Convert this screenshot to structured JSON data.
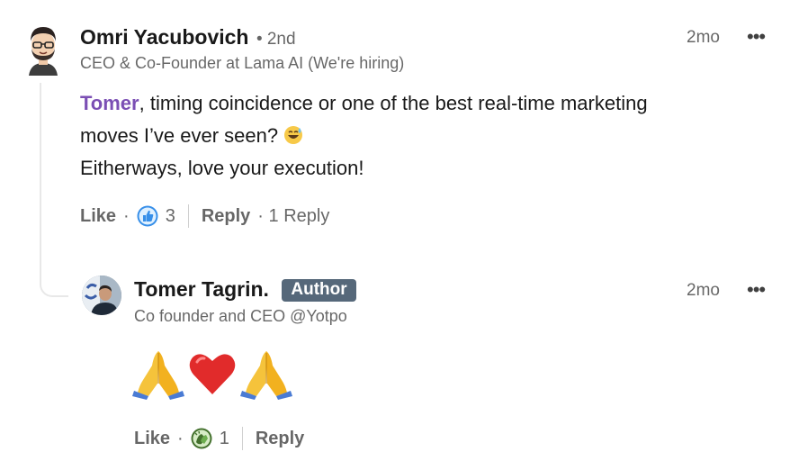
{
  "comment": {
    "author_name": "Omri Yacubovich",
    "degree": "• 2nd",
    "headline": "CEO & Co-Founder at Lama AI (We're hiring)",
    "time": "2mo",
    "more": "•••",
    "mention": "Tomer",
    "line1_rest": ", timing coincidence or one of the best real-time marketing",
    "line2": "moves I’ve ever seen?",
    "line2_emoji": "grinning-sweat-emoji",
    "line3": "Eitherways, love your execution!",
    "like_label": "Like",
    "reaction_icon": "thumbs-up-like-icon",
    "reaction_count": "3",
    "reply_label": "Reply",
    "replies_count_label": "· 1 Reply"
  },
  "reply": {
    "author_name": "Tomer Tagrin.",
    "badge": "Author",
    "headline": "Co founder and CEO @Yotpo",
    "time": "2mo",
    "more": "•••",
    "emojis": [
      "folded-hands-emoji",
      "red-heart-emoji",
      "folded-hands-emoji"
    ],
    "like_label": "Like",
    "reaction_icon": "clapping-celebrate-icon",
    "reaction_count": "1",
    "reply_label": "Reply"
  },
  "colors": {
    "mention": "#7b4fb4",
    "badge_bg": "#56687a",
    "like_blue": "#378fe9",
    "celebrate_green": "#44712e"
  }
}
